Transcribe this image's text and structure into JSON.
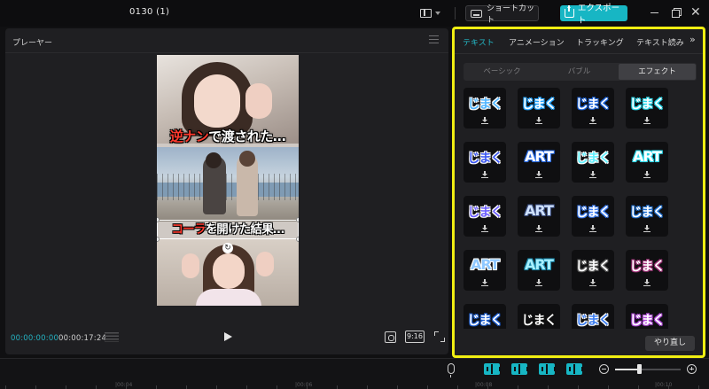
{
  "header": {
    "project_title": "0130 (1)",
    "shortcut_label": "ショートカット",
    "export_label": "エクスポート",
    "close_glyph": "✕"
  },
  "player": {
    "title": "プレーヤー",
    "current_time": "00:00:00:00",
    "total_time": "00:00:17:24",
    "ratio_label": "9:16",
    "caption_top": {
      "part1": "逆ナン",
      "part1b": "",
      "part2": "で渡された…"
    },
    "caption_mid": {
      "part1": "コーラ",
      "part2": "を開けた結果…"
    },
    "rotate_glyph": "↻"
  },
  "text_panel": {
    "tabs": [
      "テキスト",
      "アニメーション",
      "トラッキング",
      "テキスト読み"
    ],
    "active_tab": "テキスト",
    "more_glyph": "»",
    "segments": [
      "ベーシック",
      "バブル",
      "エフェクト"
    ],
    "active_segment": "エフェクト",
    "effects": [
      {
        "text": "じまく",
        "fill": "#4fb4ff",
        "stroke": "#ffffff"
      },
      {
        "text": "じまく",
        "fill": "#ffffff",
        "stroke": "#22a3ff"
      },
      {
        "text": "じまく",
        "fill": "#ffffff",
        "stroke": "#1b62d8"
      },
      {
        "text": "じまく",
        "fill": "#ffffff",
        "stroke": "#27d6e8"
      },
      {
        "text": "じまく",
        "fill": "#3a56f0",
        "stroke": "#ffffff"
      },
      {
        "text": "ART",
        "fill": "#ffffff",
        "stroke": "#2467e0"
      },
      {
        "text": "じまく",
        "fill": "#5ff0ff",
        "stroke": "#ffffff"
      },
      {
        "text": "ART",
        "fill": "#ffffff",
        "stroke": "#27d6e8"
      },
      {
        "text": "じまく",
        "fill": "#6a5cff",
        "stroke": "#ffffff"
      },
      {
        "text": "ART",
        "fill": "#cfe2ff",
        "stroke": "#394b7a"
      },
      {
        "text": "じまく",
        "fill": "#ffffff",
        "stroke": "#3c7cf0"
      },
      {
        "text": "じまく",
        "fill": "#ffffff",
        "stroke": "#1f6fcf"
      },
      {
        "text": "ART",
        "fill": "#8fc8ff",
        "stroke": "#ffffff"
      },
      {
        "text": "ART",
        "fill": "#a6f0ff",
        "stroke": "#1a86a8"
      },
      {
        "text": "じまく",
        "fill": "#ffffff",
        "stroke": "#5a5a5a"
      },
      {
        "text": "じまく",
        "fill": "#ffffff",
        "stroke": "#a3327a"
      },
      {
        "text": "じまく",
        "fill": "#ffffff",
        "stroke": "#1e5fd0"
      },
      {
        "text": "じまく",
        "fill": "#ffffff",
        "stroke": "#111111"
      },
      {
        "text": "じまく",
        "fill": "#3a7cf0",
        "stroke": "#ffffff"
      },
      {
        "text": "じまく",
        "fill": "#ffffff",
        "stroke": "#b04ad8"
      }
    ],
    "reset_label": "やり直し"
  },
  "timeline": {
    "ruler_labels": [
      "|00:04",
      "|00:06",
      "|00:08",
      "|00:10"
    ],
    "zoom_level": 0.37
  },
  "colors": {
    "accent": "#17b6c4",
    "highlight_border": "#f0ee12"
  }
}
